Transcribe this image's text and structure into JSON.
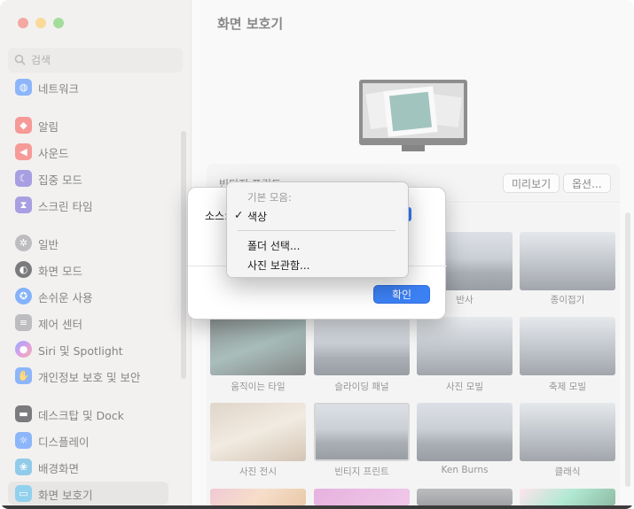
{
  "sidebar": {
    "search_placeholder": "검색",
    "items": [
      {
        "label": "네트워크",
        "icon": "globe-icon",
        "color": "#3b82f6"
      },
      {
        "label": "알림",
        "icon": "bell-icon",
        "color": "#f0524e"
      },
      {
        "label": "사운드",
        "icon": "speaker-icon",
        "color": "#f0524e"
      },
      {
        "label": "집중 모드",
        "icon": "moon-icon",
        "color": "#6a5acd"
      },
      {
        "label": "스크린 타임",
        "icon": "hourglass-icon",
        "color": "#6a5acd"
      },
      {
        "label": "일반",
        "icon": "gear-icon",
        "color": "#8e8e93"
      },
      {
        "label": "화면 모드",
        "icon": "appearance-icon",
        "color": "#1d1d1f"
      },
      {
        "label": "손쉬운 사용",
        "icon": "accessibility-icon",
        "color": "#2f7bf6"
      },
      {
        "label": "제어 센터",
        "icon": "control-center-icon",
        "color": "#8e8e93"
      },
      {
        "label": "Siri 및 Spotlight",
        "icon": "siri-icon",
        "color": "#c05ad6"
      },
      {
        "label": "개인정보 보호 및 보안",
        "icon": "hand-icon",
        "color": "#3b82f6"
      },
      {
        "label": "데스크탑 및 Dock",
        "icon": "dock-icon",
        "color": "#1d1d1f"
      },
      {
        "label": "디스플레이",
        "icon": "sun-icon",
        "color": "#3b82f6"
      },
      {
        "label": "배경화면",
        "icon": "flower-icon",
        "color": "#42a5d9"
      },
      {
        "label": "화면 보호기",
        "icon": "screensaver-icon",
        "color": "#42b0e0"
      }
    ]
  },
  "main": {
    "title": "화면 보호기",
    "current_name": "빈티지 프린트",
    "preview_button": "미리보기",
    "options_button": "옵션...",
    "thumbnails": [
      {
        "label": "반사"
      },
      {
        "label": "종이접기"
      },
      {
        "label": "움직이는 타일"
      },
      {
        "label": "슬라이딩 패널"
      },
      {
        "label": "사진 모빌"
      },
      {
        "label": "축제 모빌"
      },
      {
        "label": "사진 전시"
      },
      {
        "label": "빈티지 프린트"
      },
      {
        "label": "Ken Burns"
      },
      {
        "label": "클래식"
      }
    ]
  },
  "sheet": {
    "source_label": "소스:",
    "ok_button": "확인"
  },
  "menu": {
    "header": "기본 모음:",
    "checked_item": "색상",
    "checkmark": "✓",
    "folder_item": "폴더 선택...",
    "photos_item": "사진 보관함..."
  }
}
